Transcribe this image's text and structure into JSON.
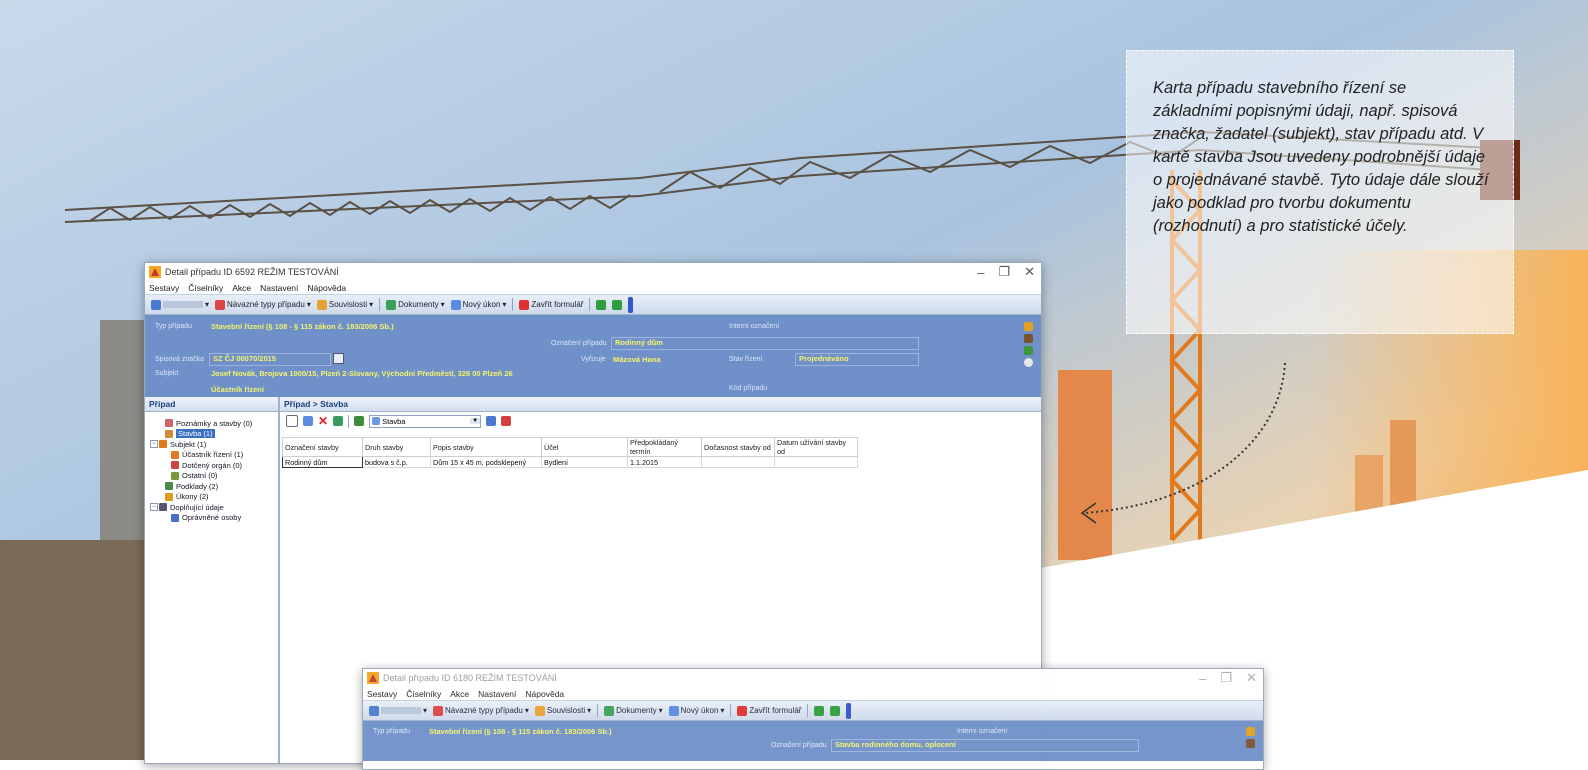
{
  "note": {
    "text": "Karta případu stavebního řízení se základními popisnými údaji, např. spisová značka, žadatel (subjekt), stav případu atd. V kartě stavba Jsou uvedeny podrobnější údaje o projednávané stavbě. Tyto údaje dále slouží jako podklad pro tvorbu dokumentu (rozhodnutí) a pro statistické účely."
  },
  "main_window": {
    "title": "Detail případu ID 6592 REŽIM TESTOVÁNÍ",
    "controls": [
      "–",
      "❐",
      "✕"
    ],
    "menu": [
      "Sestavy",
      "Číselníky",
      "Akce",
      "Nastavení",
      "Nápověda"
    ],
    "toolbar": {
      "related_types": "Návazné typy případu",
      "links": "Souvislosti",
      "documents": "Dokumenty",
      "new_act": "Nový úkon",
      "close_form": "Zavřít formulář"
    },
    "header": {
      "case_type_label": "Typ případu",
      "case_type_value": "Stavební řízení (§ 108 - § 115 zákon č. 183/2006 Sb.)",
      "internal_label": "Interní označení",
      "designation_label": "Označení případu",
      "designation_value": "Rodinný dům",
      "file_no_label": "Spisová značka",
      "file_no_value": "SZ ČJ 00070/2015",
      "handler_label": "Vyřizuje",
      "handler_value": "Mázová Hana",
      "state_label": "Stav řízení",
      "state_value": "Projednáváno",
      "subject_label": "Subjekt",
      "subject_value": "Josef Novák, Brojova 1900/15, Plzeň 2-Slovany, Východní Předměstí, 326 00 Plzeň 26",
      "participant_value": "Účastník řízení",
      "case_code_label": "Kód případu"
    },
    "left_panel": {
      "title": "Případ",
      "items": [
        {
          "label": "Poznámky a stavby (0)",
          "level": 1
        },
        {
          "label": "Stavba (1)",
          "level": 1,
          "selected": true
        },
        {
          "label": "Subjekt (1)",
          "level": 1
        },
        {
          "label": "Účastník řízení (1)",
          "level": 2
        },
        {
          "label": "Dotčený orgán (0)",
          "level": 2
        },
        {
          "label": "Ostatní (0)",
          "level": 2
        },
        {
          "label": "Podklady (2)",
          "level": 1
        },
        {
          "label": "Úkony (2)",
          "level": 1
        },
        {
          "label": "Doplňující údaje",
          "level": 1
        },
        {
          "label": "Oprávněné osoby",
          "level": 2
        }
      ]
    },
    "right_panel": {
      "title": "Případ > Stavba",
      "filter_value": "Stavba",
      "columns": [
        "Označení stavby",
        "Druh stavby",
        "Popis stavby",
        "Účel",
        "Předpokládaný termín",
        "Dočasnost stavby od",
        "Datum užívání stavby od"
      ],
      "rows": [
        [
          "Rodinný dům",
          "budova s č.p.",
          "Dům 15 x 45 m, podsklepený",
          "Bydlení",
          "1.1.2015",
          "",
          ""
        ]
      ]
    }
  },
  "second_window": {
    "title": "Detail případu ID 6180 REŽIM TESTOVÁNÍ",
    "controls": [
      "–",
      "❐",
      "✕"
    ],
    "menu": [
      "Sestavy",
      "Číselníky",
      "Akce",
      "Nastavení",
      "Nápověda"
    ],
    "toolbar": {
      "related_types": "Návazné typy případu",
      "links": "Souvislosti",
      "documents": "Dokumenty",
      "new_act": "Nový úkon",
      "close_form": "Zavřít formulář"
    },
    "header": {
      "case_type_label": "Typ případu",
      "case_type_value": "Stavební řízení (§ 108 - § 115 zákon č. 183/2006 Sb.)",
      "internal_label": "Interní označení",
      "designation_label": "Označení případu",
      "designation_value": "Stavba rodinného domu, oplocení"
    }
  }
}
